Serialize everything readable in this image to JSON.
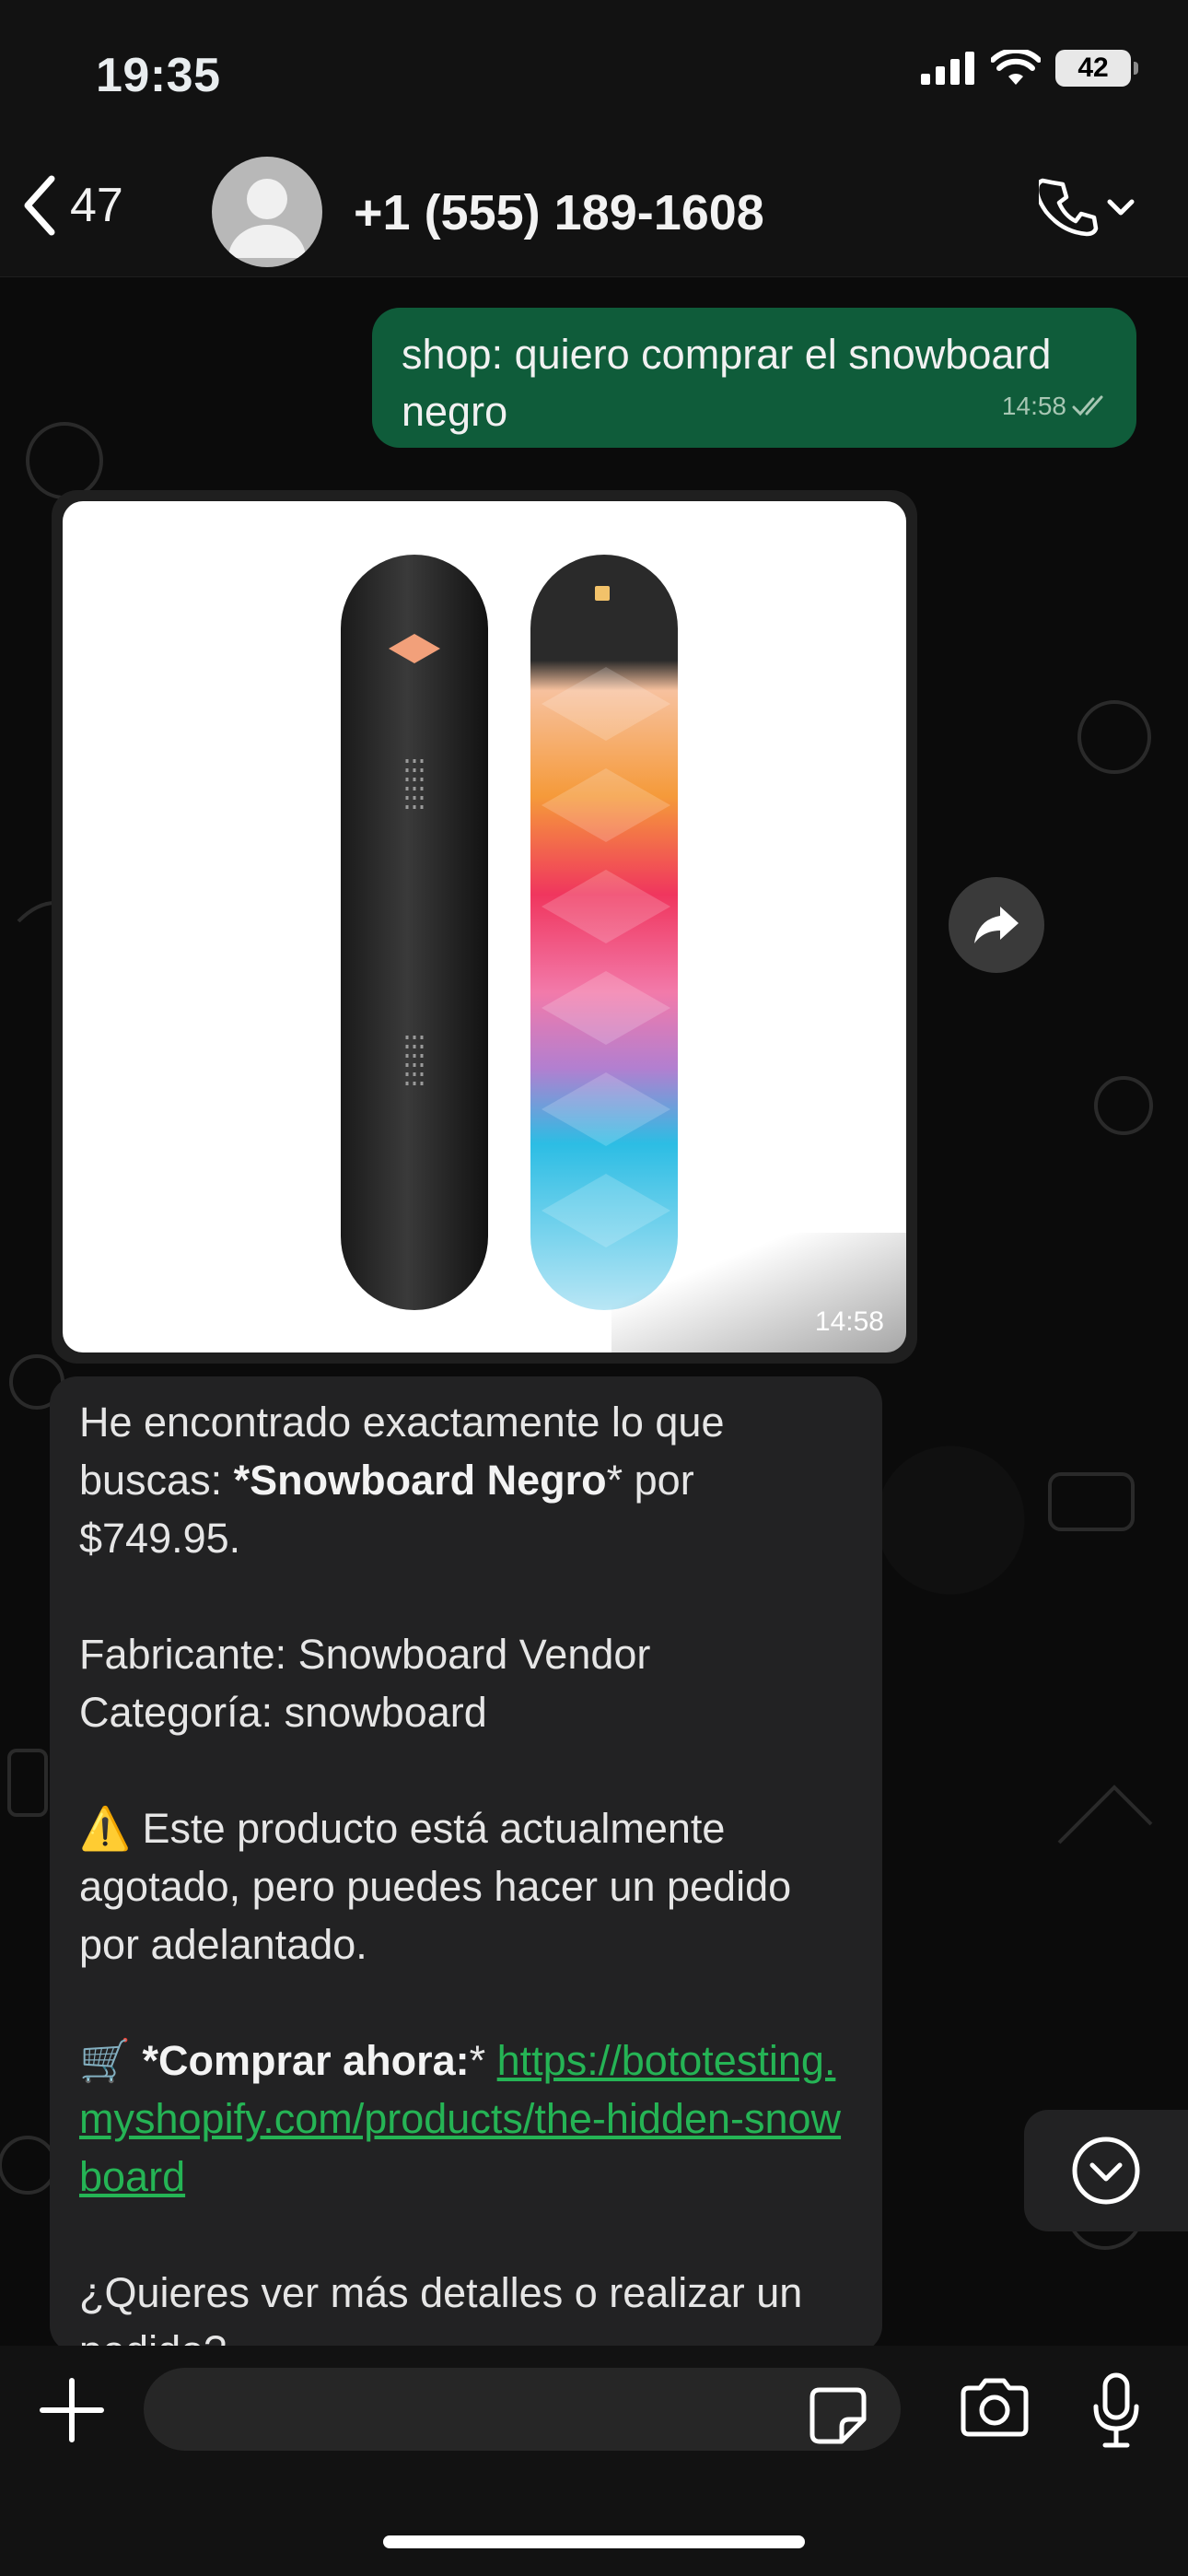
{
  "status_bar": {
    "time": "19:35",
    "battery": "42"
  },
  "header": {
    "back_count": "47",
    "contact": "+1 (555) 189-1608"
  },
  "messages": {
    "outgoing": {
      "text": "shop: quiero comprar el snowboard negro",
      "time": "14:58"
    },
    "image": {
      "time": "14:58"
    },
    "incoming": {
      "line1_a": "He encontrado exactamente lo que buscas: ",
      "line1_bold": "*Snowboard Negro",
      "line1_b": "* por $749.95.",
      "fabricante": "Fabricante: Snowboard Vendor",
      "categoria": "Categoría: snowboard",
      "warning_emoji": "⚠️",
      "warning_text": "Este producto está actualmente agotado, pero puedes hacer un pedido por adelantado.",
      "cart_emoji": "🛒",
      "buy_label": "*Comprar ahora:",
      "buy_star": "* ",
      "link": "https://bototesting.myshopify.com/products/the-hidden-snowboard",
      "question": "¿Quieres ver más detalles o realizar un pedido?"
    }
  },
  "colors": {
    "outgoing_bubble": "#0f5c3a",
    "incoming_bubble": "#222223",
    "link": "#25b455"
  },
  "icons": [
    "back-icon",
    "signal-icon",
    "wifi-icon",
    "battery-icon",
    "avatar-icon",
    "phone-icon",
    "chevron-down-icon",
    "read-receipt-icon",
    "forward-icon",
    "scroll-down-icon",
    "plus-icon",
    "sticker-icon",
    "camera-icon",
    "mic-icon"
  ]
}
